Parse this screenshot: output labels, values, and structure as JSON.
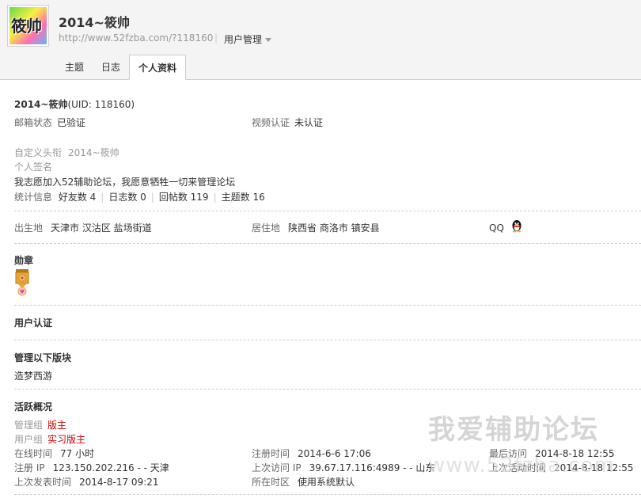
{
  "header": {
    "username": "2014~筱帅",
    "url": "http://www.52fzba.com/?118160",
    "manage_label": "用户管理",
    "avatar_text": "筱帅"
  },
  "tabs": [
    {
      "label": "主题"
    },
    {
      "label": "日志"
    },
    {
      "label": "个人资料"
    }
  ],
  "profile": {
    "name": "2014~筱帅",
    "uid": "(UID: 118160)",
    "email_label": "邮箱状态",
    "email_value": "已验证",
    "video_label": "视频认证",
    "video_value": "未认证",
    "custom_title_label": "自定义头衔",
    "custom_title_value": "2014~筱帅",
    "signature_label": "个人签名",
    "signature_text": "我志愿加入52辅助论坛，我愿意牺牲一切来管理论坛",
    "stats_label": "统计信息",
    "friends": "好友数 4",
    "blogs": "日志数 0",
    "replies": "回帖数 119",
    "threads": "主题数 16",
    "birthplace_label": "出生地",
    "birthplace_value": "天津市 汉沽区 盐场街道",
    "residence_label": "居住地",
    "residence_value": "陕西省 商洛市 镇安县",
    "qq_label": "QQ"
  },
  "sections": {
    "medals": "勋章",
    "verification": "用户认证",
    "moderated_title": "管理以下版块",
    "moderated_forum": "造梦西游",
    "activity_title": "活跃概况"
  },
  "activity": {
    "admin_group_label": "管理组",
    "admin_group_value": "版主",
    "user_group_label": "用户组",
    "user_group_value": "实习版主",
    "online_label": "在线时间",
    "online_value": "77 小时",
    "register_time_label": "注册时间",
    "register_time_value": "2014-6-6 17:06",
    "last_visit_label": "最后访问",
    "last_visit_value": "2014-8-18 12:55",
    "register_ip_label": "注册 IP",
    "register_ip_value": "123.150.202.216 - - 天津",
    "last_ip_label": "上次访问 IP",
    "last_ip_value": "39.67.17.116:4989 - - 山东",
    "last_active_label": "上次活动时间",
    "last_active_value": "2014-8-18 12:55",
    "last_post_label": "上次发表时间",
    "last_post_value": "2014-8-17 09:21",
    "timezone_label": "所在时区",
    "timezone_value": "使用系统默认"
  },
  "watermark": {
    "line1": "我爱辅助论坛",
    "line2": "www.52fzba.com"
  },
  "colors": {
    "accent_red": "#cc0000",
    "header_bg": "#f4f4f4"
  }
}
